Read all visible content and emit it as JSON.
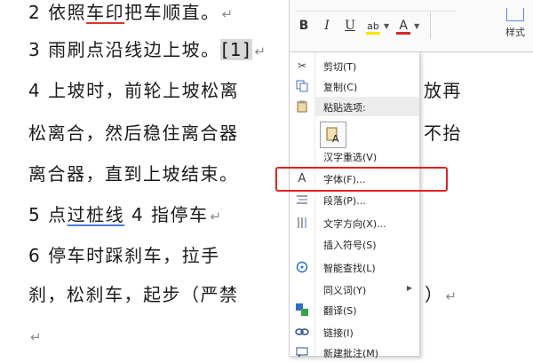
{
  "document": {
    "lines": [
      {
        "prefix": "2 依照",
        "underlined": "车印",
        "middle": "把车顺直。"
      },
      {
        "text": "3 雨刷点沿线边上坡。",
        "ref": "[1]"
      },
      {
        "text": "4 上坡时，前轮上坡松离",
        "tail": "放再"
      },
      {
        "text": "松离合，然后稳住离合器",
        "tail": "不抬"
      },
      {
        "text": "离合器，直到上坡结束。"
      },
      {
        "prefix": "5 点",
        "underlined": "过桩线",
        "middle": " 4 指停车"
      },
      {
        "text": "6 停车时踩刹车，拉手"
      },
      {
        "text": "刹，松刹车，起步（严禁",
        "tail": "）"
      }
    ],
    "paragraph_mark": "↵"
  },
  "mini_toolbar": {
    "bold": "B",
    "italic": "I",
    "underline": "U",
    "highlight": "ab",
    "font_color": "A",
    "styles_label": "样式",
    "highlight_color": "#f5e600",
    "font_color_value": "#d22a2a"
  },
  "context_menu": {
    "items": {
      "cut": "剪切(T)",
      "copy": "复制(C)",
      "paste_header": "粘贴选项:",
      "reconvert": "汉字重选(V)",
      "font": "字体(F)...",
      "paragraph": "段落(P)...",
      "text_direction": "文字方向(X)...",
      "insert_symbol": "插入符号(S)",
      "smart_lookup": "智能查找(L)",
      "synonyms": "同义词(Y)",
      "translate": "翻译(S)",
      "link": "链接(I)",
      "new_comment": "新建批注(M)"
    },
    "icons": {
      "cut": "scissors-icon",
      "copy": "copy-icon",
      "paste": "paste-icon",
      "font": "font-icon",
      "paragraph": "paragraph-icon",
      "text_direction": "text-direction-icon",
      "smart_lookup": "smart-lookup-icon",
      "translate": "translate-icon",
      "link": "link-icon",
      "new_comment": "new-comment-icon"
    },
    "highlighted_item": "font",
    "highlight_color": "#e0221f"
  }
}
